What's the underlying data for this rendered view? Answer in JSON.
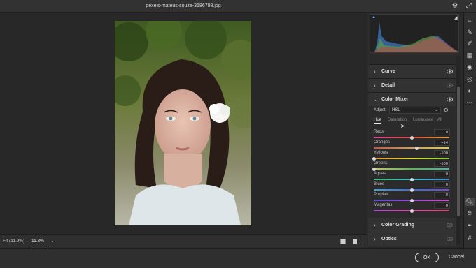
{
  "window": {
    "title": "pexels-mateus-souza-3586798.jpg"
  },
  "bottombar": {
    "fit_label": "Fit (11.9%)",
    "zoom_value": "11.3%"
  },
  "sections": {
    "curve": "Curve",
    "detail": "Detail",
    "color_mixer": "Color Mixer",
    "color_grading": "Color Grading",
    "optics": "Optics"
  },
  "color_mixer": {
    "adjust_label": "Adjust",
    "adjust_value": "HSL",
    "tabs": [
      "Hue",
      "Saturation",
      "Luminance",
      "All"
    ],
    "active_tab": "Hue",
    "sliders": [
      {
        "label": "Reds",
        "value": "0",
        "pos": 0.5
      },
      {
        "label": "Oranges",
        "value": "+14",
        "pos": 0.57
      },
      {
        "label": "Yellows",
        "value": "-100",
        "pos": 0.0
      },
      {
        "label": "Greens",
        "value": "-100",
        "pos": 0.0
      },
      {
        "label": "Aquas",
        "value": "0",
        "pos": 0.5
      },
      {
        "label": "Blues",
        "value": "0",
        "pos": 0.5
      },
      {
        "label": "Purples",
        "value": "0",
        "pos": 0.5
      },
      {
        "label": "Magentas",
        "value": "0",
        "pos": 0.5
      }
    ]
  },
  "footer": {
    "ok_label": "OK",
    "cancel_label": "Cancel"
  }
}
